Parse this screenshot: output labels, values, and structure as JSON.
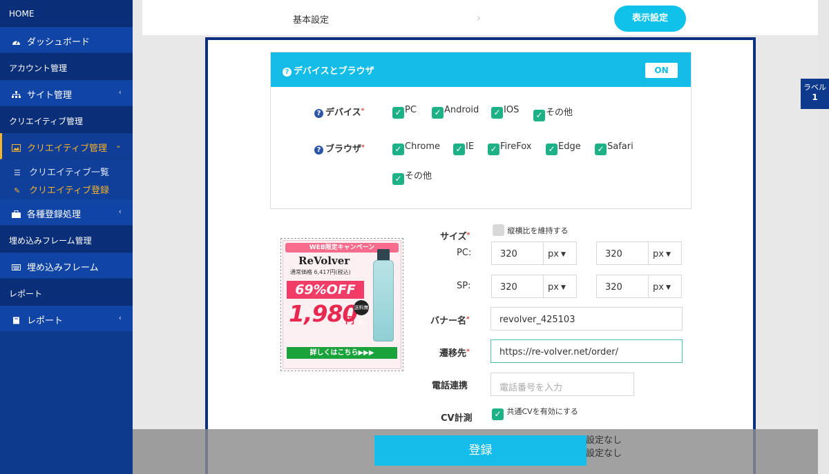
{
  "sidebar": {
    "home": "HOME",
    "dashboard": "ダッシュボード",
    "account_section": "アカウント管理",
    "site_manage": "サイト管理",
    "creative_section": "クリエイティブ管理",
    "creative_manage": "クリエイティブ管理",
    "creative_list": "クリエイティブ一覧",
    "creative_register": "クリエイティブ登録",
    "registrations": "各種登録処理",
    "frame_section": "埋め込みフレーム管理",
    "frame": "埋め込みフレーム",
    "report_section": "レポート",
    "report": "レポート"
  },
  "header": {
    "step_basic": "基本設定",
    "step_display": "表示設定"
  },
  "label_badge": {
    "text": "ラベル",
    "number": "1"
  },
  "device_card": {
    "title": "デバイスとブラウザ",
    "toggle": "ON",
    "device_label": "デバイス",
    "devices": [
      "PC",
      "Android",
      "IOS",
      "その他"
    ],
    "browser_label": "ブラウザ",
    "browsers": [
      "Chrome",
      "IE",
      "FireFox",
      "Edge",
      "Safari",
      "その他"
    ]
  },
  "banner": {
    "campaign": "WEB限定キャンペーン",
    "brand": "ReVolver",
    "price_old": "通常価格 6,417円(税込)",
    "off": "69%OFF",
    "price": "1,980",
    "yen": "円",
    "badge": "送料無料",
    "cta": "詳しくはこちら▶▶▶"
  },
  "form": {
    "size_label": "サイズ",
    "keep_ratio": "縦横比を維持する",
    "pc_label": "PC:",
    "sp_label": "SP:",
    "pc_width": "320",
    "pc_height": "320",
    "sp_width": "320",
    "sp_height": "320",
    "unit": "px",
    "banner_name_label": "バナー名",
    "banner_name": "revolver_425103",
    "dest_label": "遷移先",
    "dest_url": "https://re-volver.net/order/",
    "phone_label": "電話連携",
    "phone_placeholder": "電話番号を入力",
    "cv_label": "CV計測",
    "cv_common": "共通CVを有効にする",
    "no_setting_1": "設定なし",
    "no_setting_2": "設定なし"
  },
  "footer": {
    "submit": "登録"
  },
  "colors": {
    "sidebar": "#0d3a8c",
    "accent": "#13bde8",
    "check": "#1eb086",
    "active": "#f6b42c"
  }
}
